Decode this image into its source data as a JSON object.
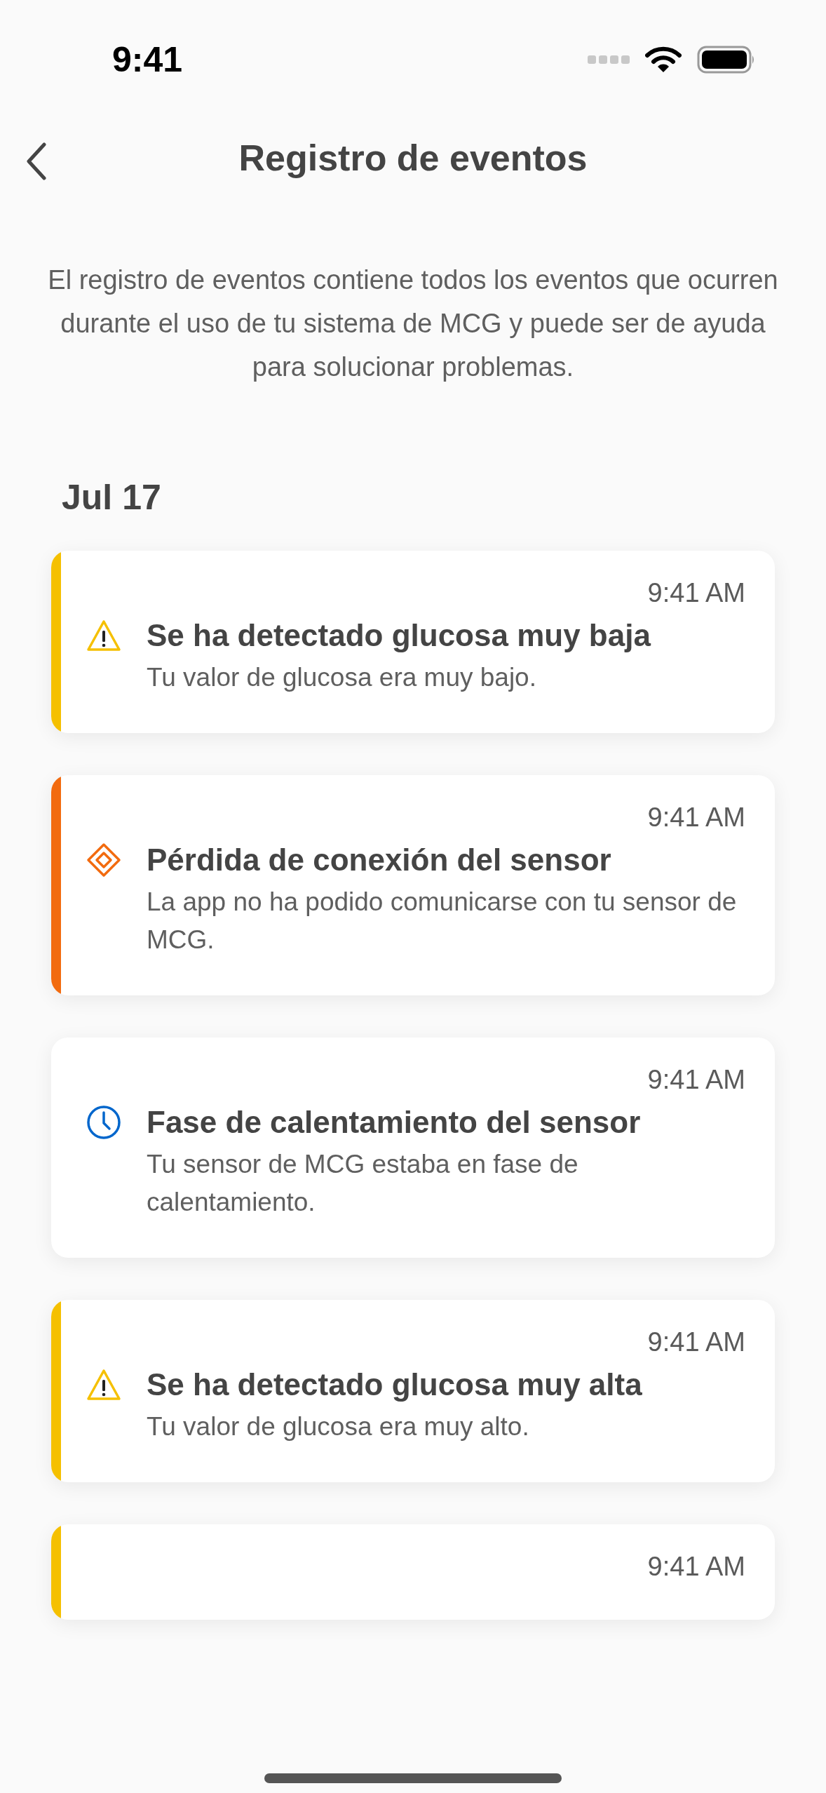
{
  "status_bar": {
    "time": "9:41"
  },
  "nav": {
    "title": "Registro de eventos"
  },
  "intro": "El registro de eventos contiene todos los eventos que ocurren durante el uso de tu sistema de MCG y puede ser de ayuda para solucionar problemas.",
  "groups": [
    {
      "date": "Jul 17",
      "events": [
        {
          "kind": "warning",
          "time": "9:41 AM",
          "title": "Se ha detectado glucosa muy baja",
          "description": "Tu valor de glucosa era muy bajo."
        },
        {
          "kind": "connection",
          "time": "9:41 AM",
          "title": "Pérdida de conexión del sensor",
          "description": "La app no ha podido comunicarse con tu sensor de MCG."
        },
        {
          "kind": "info",
          "time": "9:41 AM",
          "title": "Fase de calentamiento del sensor",
          "description": "Tu sensor de MCG estaba en fase de calentamiento."
        },
        {
          "kind": "warning",
          "time": "9:41 AM",
          "title": "Se ha detectado glucosa muy alta",
          "description": "Tu valor de glucosa era muy alto."
        },
        {
          "kind": "warning",
          "time": "9:41 AM"
        }
      ]
    }
  ]
}
